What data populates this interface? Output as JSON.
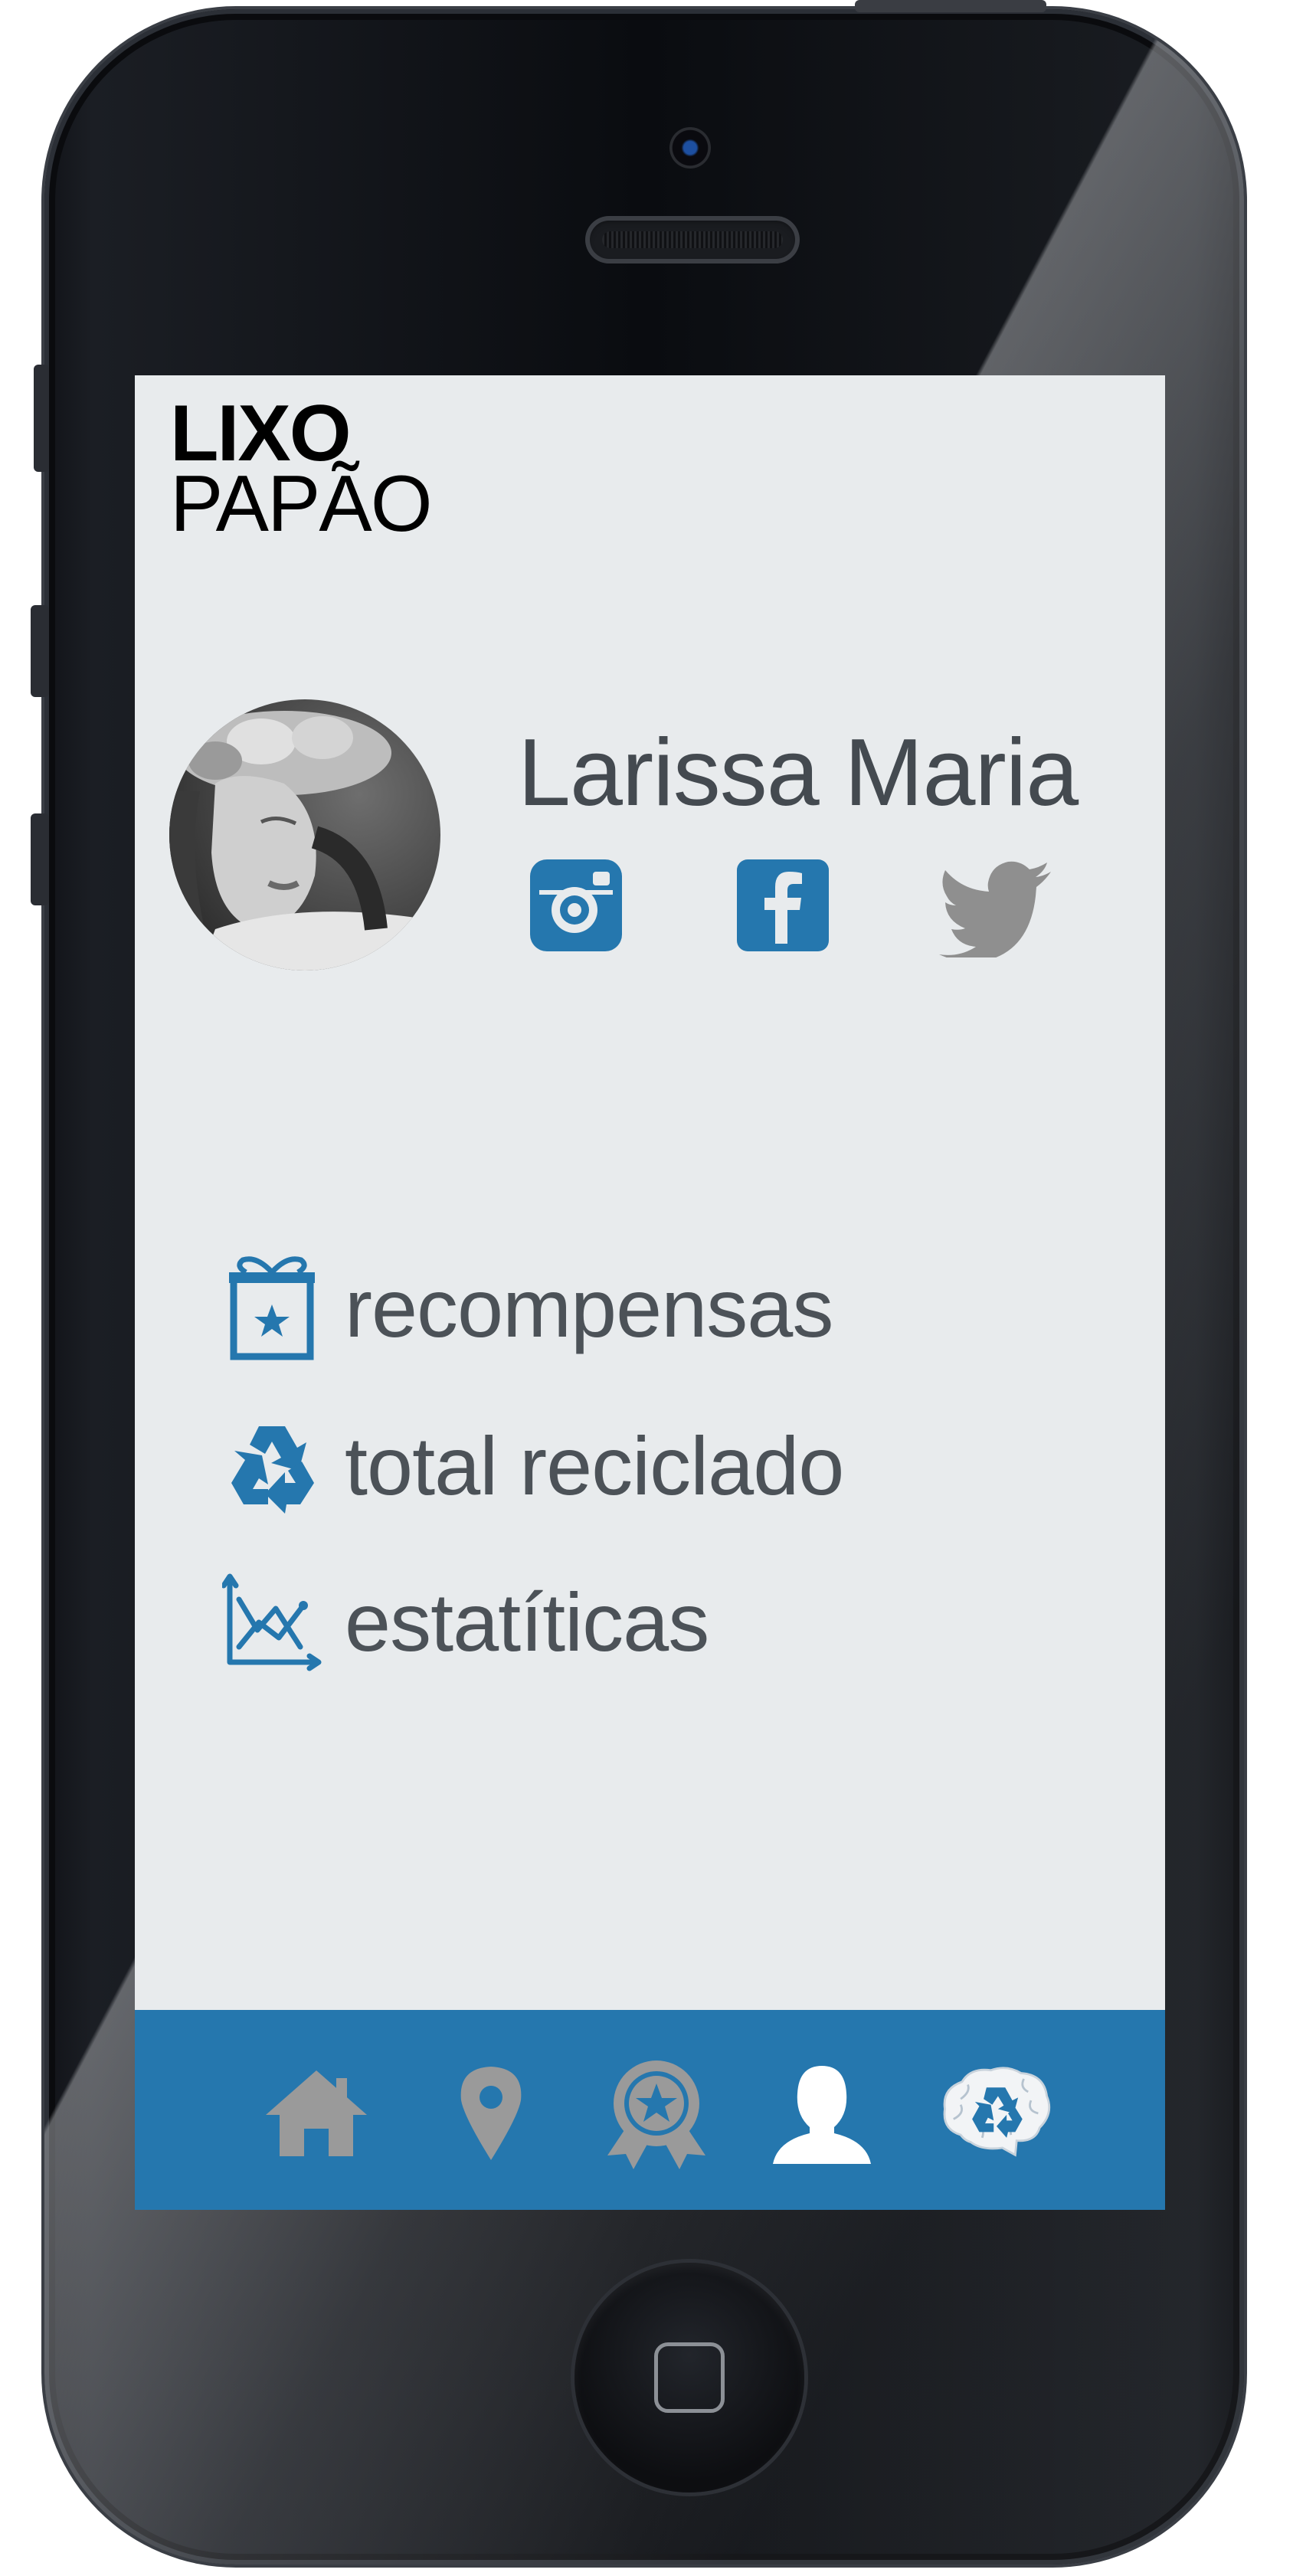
{
  "app": {
    "logo_line1": "LIXO",
    "logo_line2": "PAPÃO"
  },
  "profile": {
    "name": "Larissa Maria",
    "social": [
      {
        "name": "instagram-icon"
      },
      {
        "name": "facebook-icon"
      },
      {
        "name": "twitter-icon"
      }
    ]
  },
  "menu": {
    "items": [
      {
        "label": "recompensas",
        "icon": "gift-star-icon"
      },
      {
        "label": "total reciclado",
        "icon": "recycle-icon"
      },
      {
        "label": "estatíticas",
        "icon": "chart-icon"
      }
    ]
  },
  "tabbar": {
    "tabs": [
      {
        "icon": "home-icon"
      },
      {
        "icon": "map-pin-icon"
      },
      {
        "icon": "award-icon"
      },
      {
        "icon": "user-icon",
        "active": true
      },
      {
        "icon": "brain-recycle-icon"
      }
    ]
  },
  "colors": {
    "accent": "#2577ae",
    "screen_bg": "#e8ebed",
    "text": "#4c5258",
    "inactive_icon": "#9a9a9a"
  }
}
